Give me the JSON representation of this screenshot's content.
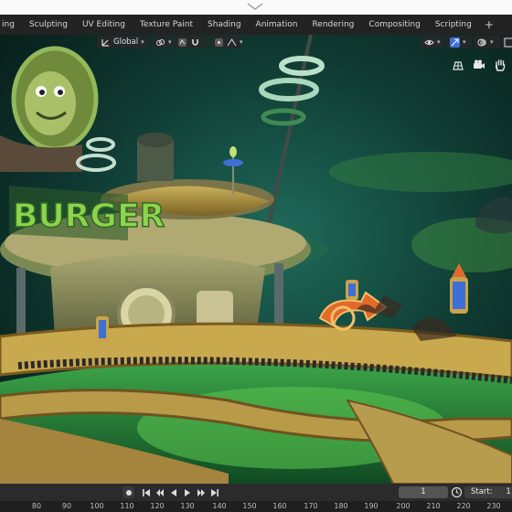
{
  "workspace_tabs": [
    "ing",
    "Sculpting",
    "UV Editing",
    "Texture Paint",
    "Shading",
    "Animation",
    "Rendering",
    "Compositing",
    "Scripting"
  ],
  "tab_add_label": "+",
  "viewport_header": {
    "transform_orientation": "Global",
    "snap_icon": "magnet-icon",
    "proportional_icon": "proportional-edit-icon"
  },
  "scene_sign_text": "BURGER",
  "nav_icons": [
    "hand-pan-icon",
    "camera-view-icon",
    "grid-view-icon"
  ],
  "timeline": {
    "current_frame": "1",
    "start_label": "Start:",
    "start_value": "1"
  },
  "ruler_ticks": [
    "80",
    "90",
    "100",
    "110",
    "120",
    "130",
    "140",
    "150",
    "160",
    "170",
    "180",
    "190",
    "200",
    "210",
    "220",
    "230"
  ],
  "colors": {
    "accent_blue": "#3e6fd6",
    "neon_green": "#7cd65a",
    "sky_teal": "#0f3a32"
  }
}
